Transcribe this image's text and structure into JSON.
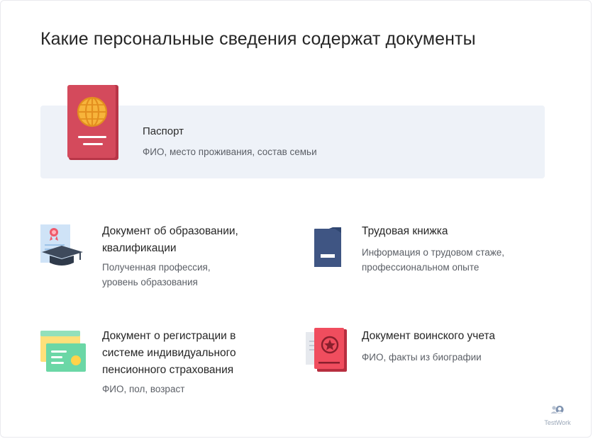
{
  "title": "Какие персональные сведения содержат документы",
  "colors": {
    "card_bg": "#eef2f8",
    "passport_red": "#d44a5c",
    "globe_yellow": "#f7b43b",
    "navy": "#3f5583",
    "military_red": "#f04d5e",
    "snils_green": "#6bd7a6"
  },
  "passport": {
    "icon": "passport-icon",
    "title": "Паспорт",
    "description": "ФИО, место проживания, состав семьи"
  },
  "items": [
    {
      "icon": "graduation-diploma-icon",
      "title": "Документ об образовании, квалификации",
      "description": "Полученная профессия, уровень образования"
    },
    {
      "icon": "work-book-icon",
      "title": "Трудовая книжка",
      "description": "Информация о трудовом стаже, профессиональном опыте"
    },
    {
      "icon": "pension-card-icon",
      "title": "Документ о регистрации в системе индивидуального пенсионного страхования",
      "description": "ФИО, пол, возраст"
    },
    {
      "icon": "military-id-icon",
      "title": "Документ воинского учета",
      "description": "ФИО, факты из биографии"
    }
  ],
  "logo": {
    "icon": "testwork-logo-icon",
    "text": "TestWork"
  }
}
